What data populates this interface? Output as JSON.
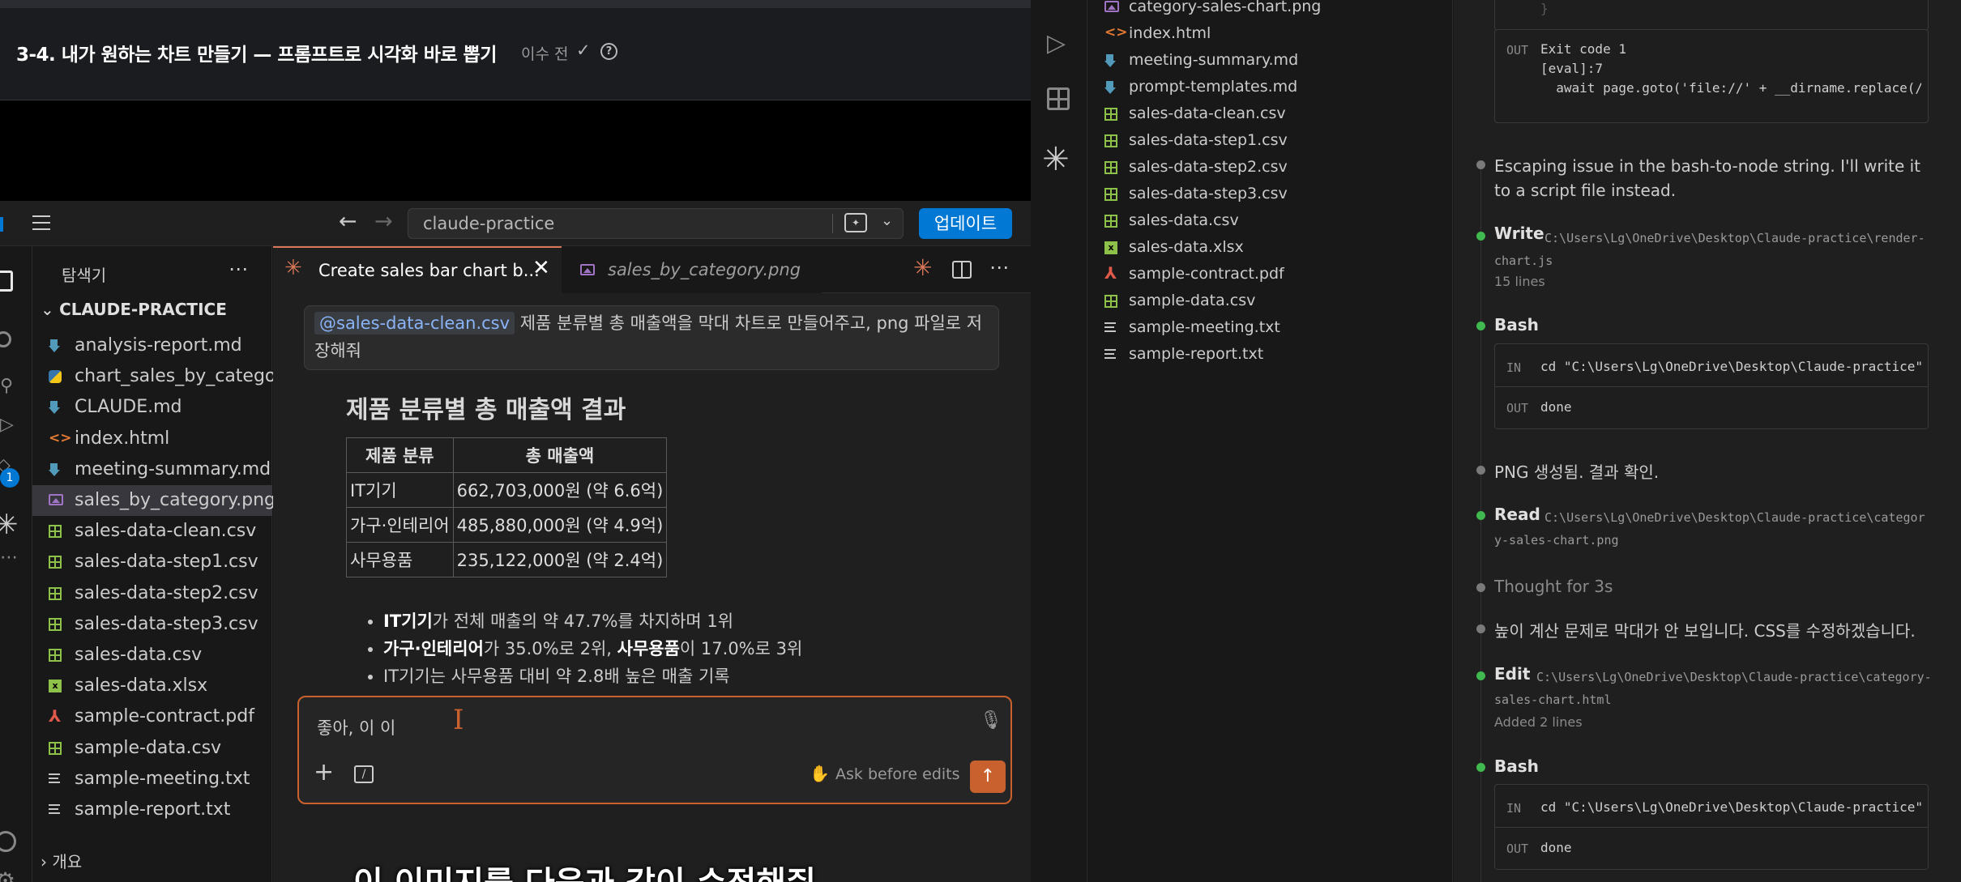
{
  "video": {
    "lesson_title": "3-4. 내가 원하는 차트 만들기 — 프롬프트로 시각화 바로 뽑기",
    "lesson_meta": "이수 전",
    "subtitle": "이 이미지를 다음과 같이 수정해줘"
  },
  "app": {
    "search_value": "claude-practice",
    "update_button": "업데이트",
    "activity_badge": "1"
  },
  "explorer": {
    "title": "탐색기",
    "root": "CLAUDE-PRACTICE",
    "items": [
      {
        "name": "analysis-report.md",
        "icon": "markdown-file-icon"
      },
      {
        "name": "chart_sales_by_catego...",
        "icon": "python-file-icon"
      },
      {
        "name": "CLAUDE.md",
        "icon": "markdown-file-icon"
      },
      {
        "name": "index.html",
        "icon": "html-file-icon"
      },
      {
        "name": "meeting-summary.md",
        "icon": "markdown-file-icon"
      },
      {
        "name": "sales_by_category.png",
        "icon": "image-file-icon"
      },
      {
        "name": "sales-data-clean.csv",
        "icon": "csv-file-icon"
      },
      {
        "name": "sales-data-step1.csv",
        "icon": "csv-file-icon"
      },
      {
        "name": "sales-data-step2.csv",
        "icon": "csv-file-icon"
      },
      {
        "name": "sales-data-step3.csv",
        "icon": "csv-file-icon"
      },
      {
        "name": "sales-data.csv",
        "icon": "csv-file-icon"
      },
      {
        "name": "sales-data.xlsx",
        "icon": "excel-file-icon"
      },
      {
        "name": "sample-contract.pdf",
        "icon": "pdf-file-icon"
      },
      {
        "name": "sample-data.csv",
        "icon": "csv-file-icon"
      },
      {
        "name": "sample-meeting.txt",
        "icon": "text-file-icon"
      },
      {
        "name": "sample-report.txt",
        "icon": "text-file-icon"
      }
    ],
    "outline": "개요"
  },
  "tabs": [
    {
      "label": "Create sales bar chart b...",
      "icon": "claude-icon"
    },
    {
      "label": "sales_by_category.png",
      "icon": "image-file-icon"
    }
  ],
  "chat": {
    "mention": "@sales-data-clean.csv",
    "prompt_text": " 제품 분류별 총 매출액을 막대 차트로 만들어주고, png 파일로 저장해줘",
    "result_heading": "제품 분류별 총 매출액 결과",
    "table": {
      "headers": [
        "제품 분류",
        "총 매출액"
      ],
      "rows": [
        [
          "IT기기",
          "662,703,000원 (약 6.6억)"
        ],
        [
          "가구·인테리어",
          "485,880,000원 (약 4.9억)"
        ],
        [
          "사무용품",
          "235,122,000원 (약 2.4억)"
        ]
      ]
    },
    "bullets": {
      "b1_strong": "IT기기",
      "b1_rest": "가 전체 매출의 약 47.7%를 차지하며 1위",
      "b2_strong": "가구·인테리어",
      "b2_mid": "가 35.0%로 2위, ",
      "b2_strong2": "사무용품",
      "b2_rest": "이 17.0%로 3위",
      "b3": "IT기기는 사무용품 대비 약 2.8배 높은 매출 기록"
    },
    "input_value": "좋아, 이 이",
    "mode_label": "Ask before edits"
  },
  "right_files": [
    {
      "name": "category-sales-chart.png",
      "icon": "image-file-icon"
    },
    {
      "name": "index.html",
      "icon": "html-file-icon"
    },
    {
      "name": "meeting-summary.md",
      "icon": "markdown-file-icon"
    },
    {
      "name": "prompt-templates.md",
      "icon": "markdown-file-icon"
    },
    {
      "name": "sales-data-clean.csv",
      "icon": "csv-file-icon"
    },
    {
      "name": "sales-data-step1.csv",
      "icon": "csv-file-icon"
    },
    {
      "name": "sales-data-step2.csv",
      "icon": "csv-file-icon"
    },
    {
      "name": "sales-data-step3.csv",
      "icon": "csv-file-icon"
    },
    {
      "name": "sales-data.csv",
      "icon": "csv-file-icon"
    },
    {
      "name": "sales-data.xlsx",
      "icon": "excel-file-icon"
    },
    {
      "name": "sample-contract.pdf",
      "icon": "pdf-file-icon"
    },
    {
      "name": "sample-data.csv",
      "icon": "csv-file-icon"
    },
    {
      "name": "sample-meeting.txt",
      "icon": "text-file-icon"
    },
    {
      "name": "sample-report.txt",
      "icon": "text-file-icon"
    }
  ],
  "log": {
    "top_out_label": "OUT",
    "top_out_line1": "Exit code 1",
    "top_out_line2": "[eval]:7",
    "top_out_line3": "  await page.goto('file://' + __dirname.replace(/\\",
    "msg1": "Escaping issue in the bash-to-node string. I'll write it to a script file instead.",
    "write_label": "Write",
    "write_path": "C:\\Users\\Lg\\OneDrive\\Desktop\\Claude-practice\\render-chart.js",
    "write_meta": "15 lines",
    "bash_label": "Bash",
    "in_label": "IN",
    "out_label": "OUT",
    "bash_cmd": "cd \"C:\\Users\\Lg\\OneDrive\\Desktop\\Claude-practice\"",
    "bash_out": "done",
    "msg2": "PNG 생성됨. 결과 확인.",
    "read_label": "Read",
    "read_path": "C:\\Users\\Lg\\OneDrive\\Desktop\\Claude-practice\\category-sales-chart.png",
    "thought": "Thought for 3s",
    "msg3": "높이 계산 문제로 막대가 안 보입니다. CSS를 수정하겠습니다.",
    "edit_label": "Edit",
    "edit_path": "C:\\Users\\Lg\\OneDrive\\Desktop\\Claude-practice\\category-sales-chart.html",
    "edit_meta": "Added 2 lines",
    "bash2_label": "Bash",
    "bash2_cmd": "cd \"C:\\Users\\Lg\\OneDrive\\Desktop\\Claude-practice\"",
    "bash2_out": "done"
  },
  "colors": {
    "accent_blue": "#0078d4",
    "claude_orange": "#d97757",
    "dot_green": "#3fb950",
    "dot_gray": "#7a7a7a"
  }
}
